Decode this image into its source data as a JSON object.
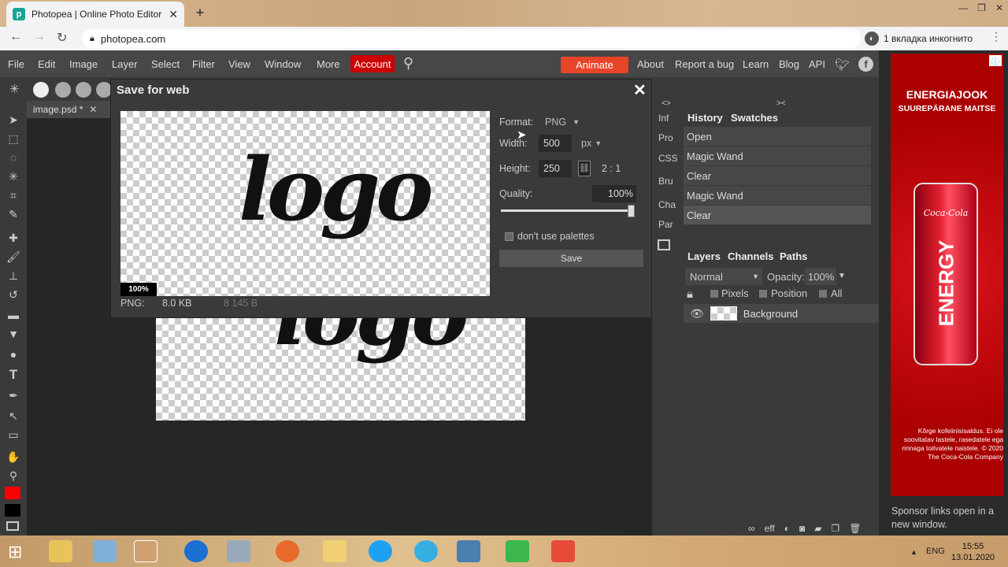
{
  "browser": {
    "tab_title": "Photopea | Online Photo Editor",
    "url": "photopea.com",
    "incognito": "1 вкладка инкогнито"
  },
  "menu": {
    "items": [
      "File",
      "Edit",
      "Image",
      "Layer",
      "Select",
      "Filter",
      "View",
      "Window",
      "More"
    ],
    "account": "Account",
    "animate": "Animate",
    "links": [
      "About",
      "Report a bug",
      "Learn",
      "Blog",
      "API"
    ]
  },
  "document": {
    "tab": "image.psd *"
  },
  "dialog": {
    "title": "Save for web",
    "format_label": "Format:",
    "format_value": "PNG",
    "width_label": "Width:",
    "width_value": "500",
    "unit": "px",
    "height_label": "Height:",
    "height_value": "250",
    "ratio": "2 : 1",
    "quality_label": "Quality:",
    "quality_value": "100%",
    "quality_level": 1.0,
    "palette_label": "don't use palettes",
    "save_label": "Save",
    "zoom": "100%",
    "file_type": "PNG:",
    "file_size": "8.0 KB",
    "file_bytes": "8 145 B",
    "preview_text": "logo"
  },
  "side_buttons": [
    "Inf",
    "Pro",
    "CSS",
    "Bru",
    "Cha",
    "Par"
  ],
  "history": {
    "tabs": [
      "History",
      "Swatches"
    ],
    "items": [
      "Open",
      "Magic Wand",
      "Clear",
      "Magic Wand",
      "Clear"
    ]
  },
  "layers": {
    "tabs": [
      "Layers",
      "Channels",
      "Paths"
    ],
    "blend": "Normal",
    "opacity_label": "Opacity:",
    "opacity": "100%",
    "lock_options": [
      "Pixels",
      "Position",
      "All"
    ],
    "layer_name": "Background"
  },
  "ad": {
    "title": "ENERGIAJOOK",
    "subtitle": "SUUREPÄRANE MAITSE",
    "can_brand": "Coca-Cola",
    "can_text": "ENERGY",
    "disclaimer": "Kõrge kofeiinisisaldus. Ei ole soovitatav lastele, rasedatele ega rinnaga toitvatele naistele. © 2020 The Coca-Cola Company",
    "sponsor_note": "Sponsor links open in a new window."
  },
  "taskbar": {
    "lang": "ENG",
    "time": "15:55",
    "date": "13.01.2020"
  },
  "colors": {
    "menubar": "#474747",
    "panel": "#3a3a3a",
    "account": "#cc0000",
    "animate": "#e8442a",
    "foreground": "#ff0000",
    "background_color": "#000000"
  }
}
